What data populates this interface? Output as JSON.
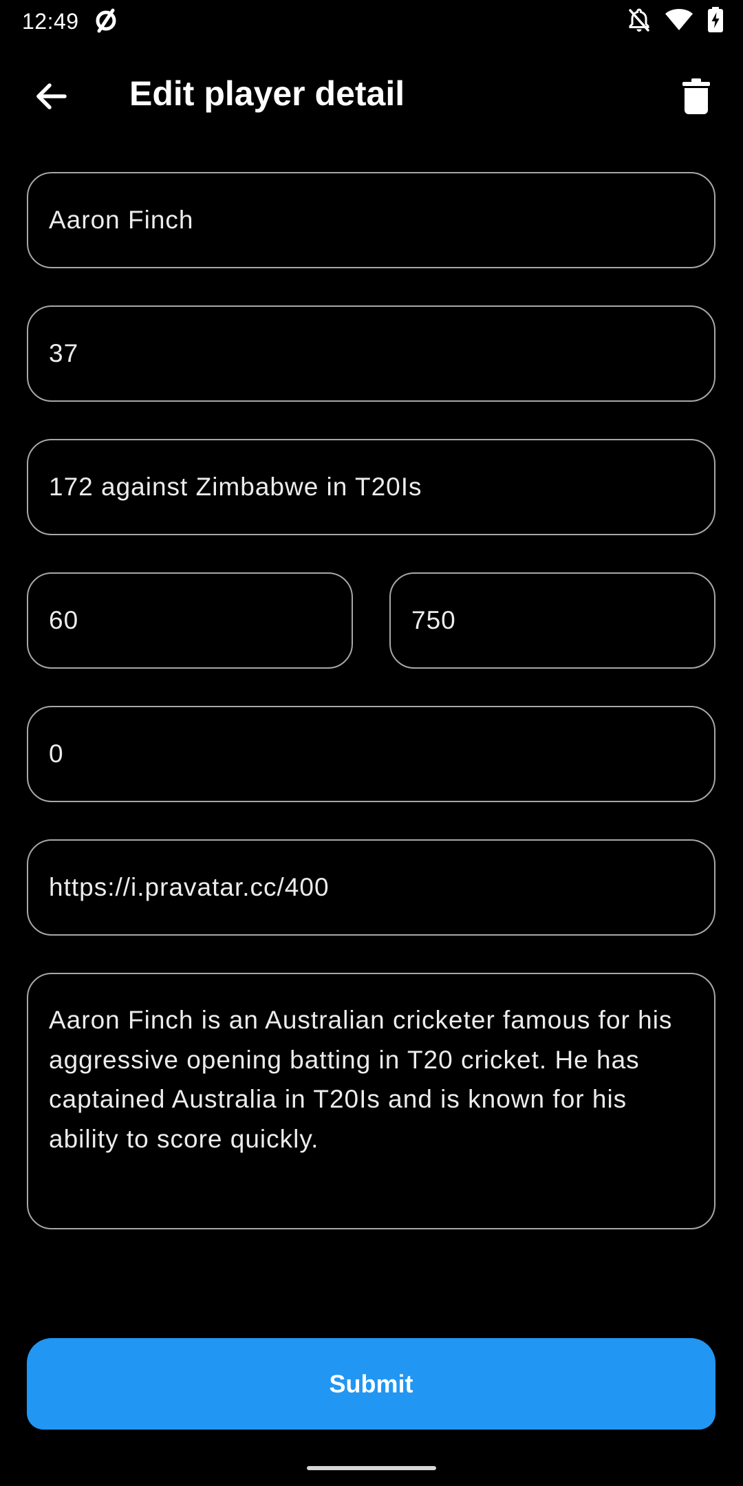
{
  "status_bar": {
    "time": "12:49",
    "icons": [
      "no-service-icon",
      "notifications-off-icon",
      "wifi-icon",
      "battery-charging-icon"
    ]
  },
  "app_bar": {
    "title": "Edit player detail",
    "back_icon": "arrow-back-icon",
    "delete_icon": "trash-icon"
  },
  "form": {
    "name": "Aaron Finch",
    "age": "37",
    "best_score": "172 against Zimbabwe in T20Is",
    "matches": "60",
    "runs": "750",
    "wickets": "0",
    "image_url": "https://i.pravatar.cc/400",
    "description": "Aaron Finch is an Australian cricketer famous for his aggressive opening batting in T20 cricket. He has captained Australia in T20Is and is known for his ability to score quickly."
  },
  "submit": {
    "label": "Submit"
  },
  "colors": {
    "background": "#000000",
    "field_border": "#a8a8a8",
    "accent": "#2196f3",
    "text": "#ffffff"
  }
}
